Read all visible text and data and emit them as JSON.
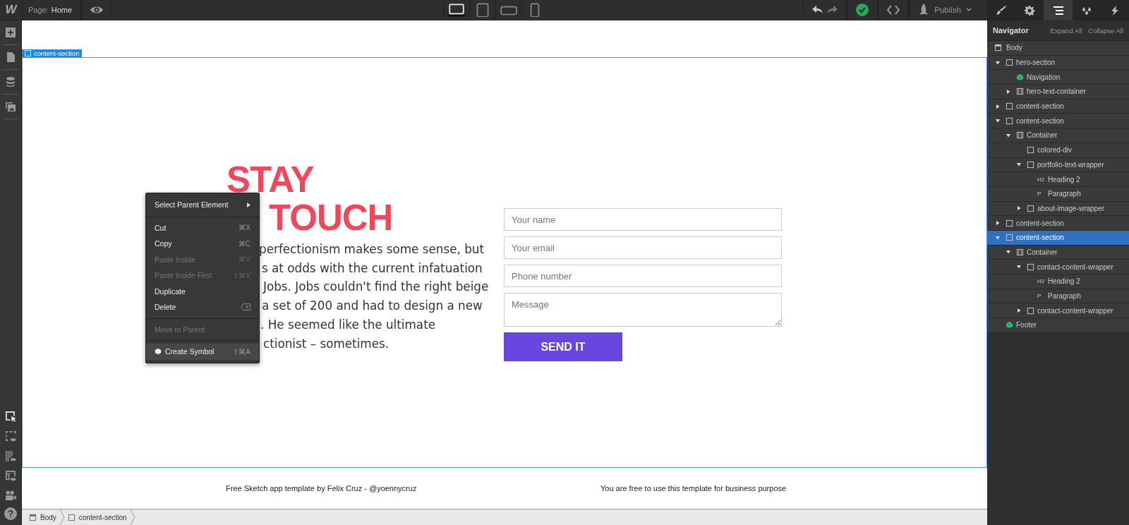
{
  "topbar": {
    "logo": "W",
    "page_label": "Page:",
    "page_name": "Home",
    "devices": [
      {
        "kind": "desktop",
        "selected": true
      },
      {
        "kind": "tablet",
        "selected": false
      },
      {
        "kind": "phone-landscape",
        "selected": false
      },
      {
        "kind": "phone",
        "selected": false
      }
    ],
    "publish": "Publish"
  },
  "panel_tabs": [
    {
      "kind": "style",
      "selected": false
    },
    {
      "kind": "settings",
      "selected": false
    },
    {
      "kind": "navigator",
      "selected": true
    },
    {
      "kind": "swatches",
      "selected": false
    },
    {
      "kind": "interactions",
      "selected": false
    }
  ],
  "left_toolbar": {
    "top": [
      {
        "kind": "add"
      },
      {
        "kind": "pages"
      },
      {
        "kind": "cms"
      },
      {
        "kind": "assets"
      }
    ],
    "bottom": [
      {
        "kind": "select"
      },
      {
        "kind": "preview"
      },
      {
        "kind": "grid"
      },
      {
        "kind": "layout"
      },
      {
        "kind": "video"
      }
    ],
    "help": "?"
  },
  "canvas": {
    "selection_label": "content-section",
    "heading_lines": [
      "STAY",
      "TOUCH"
    ],
    "paragraph_lines": [
      "perfectionism makes some sense, but",
      "s at odds with the current infatuation",
      "Jobs. Jobs couldn't find the right beige",
      "a set of 200 and had to design a new",
      ". He seemed like the ultimate",
      "ctionist – sometimes."
    ],
    "form": {
      "fields": [
        {
          "kind": "input",
          "placeholder": "Your name"
        },
        {
          "kind": "input",
          "placeholder": "Your email"
        },
        {
          "kind": "input",
          "placeholder": "Phone number"
        },
        {
          "kind": "textarea",
          "placeholder": "Message"
        }
      ],
      "button": "SEND IT"
    },
    "footer": [
      "Free Sketch app template by Felix Cruz - @yoennycruz",
      "You are free to use this template for business purpose"
    ]
  },
  "context_menu": {
    "groups": [
      [
        {
          "label": "Select Parent Element",
          "kind": "submenu",
          "disabled": false,
          "selected": false
        }
      ],
      [
        {
          "label": "Cut",
          "shortcut": "⌘X",
          "kind": "plain",
          "disabled": false,
          "selected": false
        },
        {
          "label": "Copy",
          "shortcut": "⌘C",
          "kind": "plain",
          "disabled": false,
          "selected": false
        },
        {
          "label": "Paste Inside",
          "shortcut": "⌘V",
          "kind": "plain",
          "disabled": true,
          "selected": false
        },
        {
          "label": "Paste Inside First",
          "shortcut": "⇧⌘V",
          "kind": "plain",
          "disabled": true,
          "selected": false
        },
        {
          "label": "Duplicate",
          "kind": "plain",
          "disabled": false,
          "selected": false
        },
        {
          "label": "Delete",
          "kind": "backspace",
          "disabled": false,
          "selected": false
        }
      ],
      [
        {
          "label": "Move to Parent",
          "kind": "plain",
          "disabled": true,
          "selected": false
        }
      ],
      [
        {
          "label": "Create Symbol",
          "shortcut": "⇧⌘A",
          "kind": "symbol",
          "disabled": false,
          "selected": true
        }
      ]
    ]
  },
  "navigator": {
    "title": "Navigator",
    "expand_all": "Expand All",
    "collapse_all": "Collapse All",
    "body": {
      "label": "Body",
      "children": [
        {
          "label": "hero-section",
          "kind": "box",
          "expanded": true,
          "selected": false,
          "children": [
            {
              "label": "Navigation",
              "kind": "symbol",
              "selected": false
            },
            {
              "label": "hero-text-container",
              "kind": "container",
              "expanded": false,
              "selected": false
            }
          ]
        },
        {
          "label": "content-section",
          "kind": "box",
          "expanded": false,
          "selected": false
        },
        {
          "label": "content-section",
          "kind": "box",
          "expanded": true,
          "selected": false,
          "children": [
            {
              "label": "Container",
              "kind": "container",
              "expanded": true,
              "selected": false,
              "children": [
                {
                  "label": "colored-div",
                  "kind": "box",
                  "selected": false
                },
                {
                  "label": "portfolio-text-wrapper",
                  "kind": "box",
                  "expanded": true,
                  "selected": false,
                  "children": [
                    {
                      "label": "Heading 2",
                      "kind": "text",
                      "tag": "H2",
                      "selected": false
                    },
                    {
                      "label": "Paragraph",
                      "kind": "text",
                      "tag": "P",
                      "selected": false
                    }
                  ]
                },
                {
                  "label": "about-image-wrapper",
                  "kind": "box",
                  "expanded": false,
                  "selected": false
                }
              ]
            }
          ]
        },
        {
          "label": "content-section",
          "kind": "box",
          "expanded": false,
          "selected": false
        },
        {
          "label": "content-section",
          "kind": "box",
          "expanded": true,
          "selected": true,
          "children": [
            {
              "label": "Container",
              "kind": "container",
              "expanded": true,
              "selected": false,
              "children": [
                {
                  "label": "contact-content-wrapper",
                  "kind": "box",
                  "expanded": true,
                  "selected": false,
                  "children": [
                    {
                      "label": "Heading 2",
                      "kind": "text",
                      "tag": "H2",
                      "selected": false
                    },
                    {
                      "label": "Paragraph",
                      "kind": "text",
                      "tag": "P",
                      "selected": false
                    }
                  ]
                },
                {
                  "label": "contact-content-wrapper",
                  "kind": "box",
                  "expanded": false,
                  "selected": false
                }
              ]
            }
          ]
        },
        {
          "label": "Footer",
          "kind": "symbol",
          "selected": false
        }
      ]
    }
  },
  "breadcrumb": [
    {
      "label": "Body",
      "kind": "body"
    },
    {
      "label": "content-section",
      "kind": "box"
    }
  ]
}
